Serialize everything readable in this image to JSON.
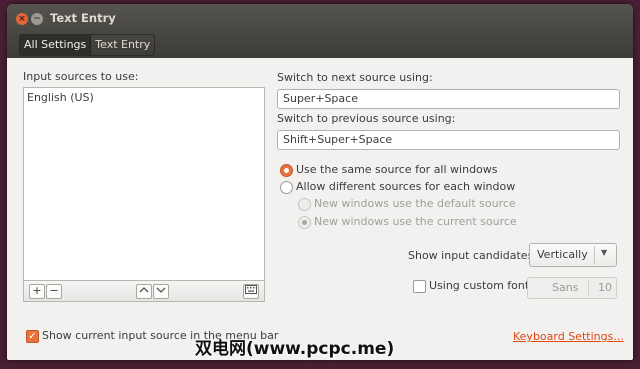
{
  "window": {
    "title": "Text Entry"
  },
  "breadcrumb": {
    "all_settings": "All Settings",
    "current": "Text Entry"
  },
  "input_sources": {
    "label": "Input sources to use:",
    "items": [
      "English (US)"
    ],
    "toolbar": {
      "add": "+",
      "remove": "−",
      "up": "⌃",
      "down": "⌄"
    }
  },
  "switch_next": {
    "label": "Switch to next source using:",
    "value": "Super+Space"
  },
  "switch_prev": {
    "label": "Switch to previous source using:",
    "value": "Shift+Super+Space"
  },
  "source_mode": {
    "same": "Use the same source for all windows",
    "different": "Allow different sources for each window",
    "sub_default": "New windows use the default source",
    "sub_current": "New windows use the current source",
    "selected": "same"
  },
  "candidates": {
    "label": "Show input candidates:",
    "value": "Vertically"
  },
  "custom_font": {
    "label": "Using custom font:",
    "font": "Sans",
    "size": "10",
    "checked": false
  },
  "show_current": {
    "label": "Show current input source in the menu bar",
    "checked": true
  },
  "keyboard_settings_link": "Keyboard Settings...",
  "watermark": "双电网(www.pcpc.me)",
  "colors": {
    "accent": "#e7733e",
    "link": "#dd4814",
    "titlebar": "#3c3b37"
  }
}
